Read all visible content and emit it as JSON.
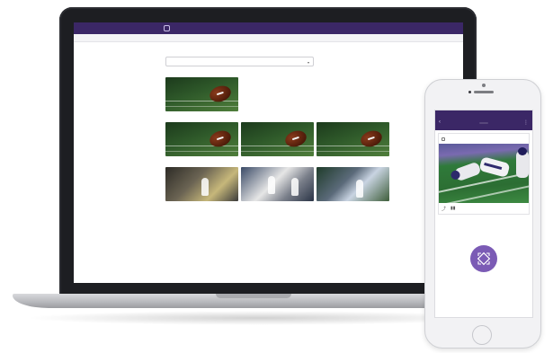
{
  "laptop": {
    "topbar": {
      "logo": "",
      "right_text": ""
    },
    "subnav": [
      "",
      "",
      "",
      ""
    ],
    "page": {
      "title": "",
      "subtitle": "",
      "select_label": "",
      "select_value": ""
    },
    "sections": [
      {
        "heading": "",
        "more": ""
      },
      {
        "heading": "",
        "more": ""
      },
      {
        "heading": "",
        "more": ""
      }
    ],
    "cards": {
      "section1": [
        ""
      ],
      "section2": [
        "",
        "",
        ""
      ],
      "section3": [
        "",
        "",
        ""
      ]
    }
  },
  "phone": {
    "status_left": "",
    "status_center": "",
    "status_right": "",
    "app_title": "",
    "card_title": "",
    "card_badge": "",
    "icons": {
      "back": "chevron-left-icon",
      "menu": "overflow-menu-icon",
      "fab": "capture-icon"
    }
  },
  "colors": {
    "brand_purple": "#3b2766",
    "fab_purple": "#7b5bb5"
  }
}
